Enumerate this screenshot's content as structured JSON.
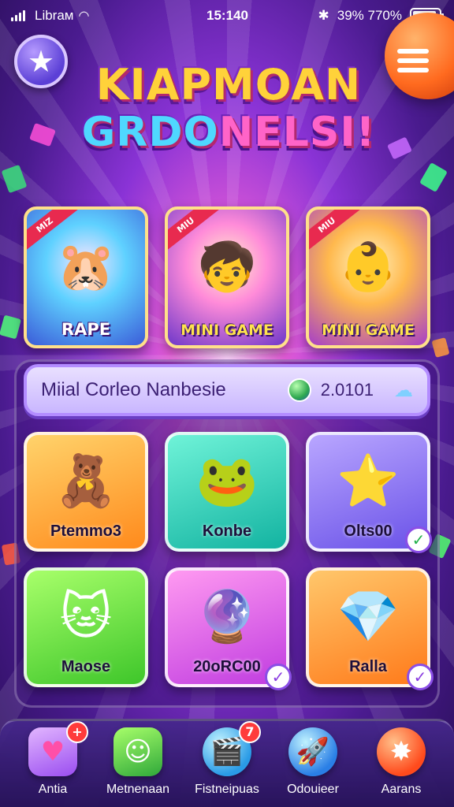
{
  "status_bar": {
    "carrier": "Librам",
    "time": "15:140",
    "battery_text": "39% 770%",
    "battery_level": 0.9
  },
  "header": {
    "title_line1": "KIAPMOAN",
    "title_line2_a": "GRDO",
    "title_line2_b": "NELSI!",
    "star_icon": "star-icon",
    "menu_icon": "hamburger-menu-icon"
  },
  "featured": [
    {
      "ribbon": "MIZ",
      "label": "RAPE",
      "art": "🐹"
    },
    {
      "ribbon": "MIU",
      "label": "MINI GAME",
      "art": "🧒"
    },
    {
      "ribbon": "MIU",
      "label": "MINI GAME",
      "art": "👶"
    }
  ],
  "search": {
    "text": "Miial Corleo Nanbesie",
    "value": "2.0101"
  },
  "games": [
    {
      "label": "Ptemmo3",
      "art": "🧸",
      "color": "orange"
    },
    {
      "label": "Konbe",
      "art": "🐸",
      "color": "teal"
    },
    {
      "label": "Olts00",
      "art": "⭐",
      "color": "purple",
      "checked": true
    },
    {
      "label": "Maose",
      "art": "🐱",
      "color": "green"
    },
    {
      "label": "20oRC00",
      "art": "🔮",
      "color": "pink",
      "checked": true
    },
    {
      "label": "Ralla",
      "art": "💎",
      "color": "amber",
      "checked": true
    }
  ],
  "bottom_nav": [
    {
      "label": "Antia",
      "icon": "heart-icon",
      "badge": "+"
    },
    {
      "label": "Metnenaan",
      "icon": "monster-icon",
      "badge": ""
    },
    {
      "label": "Fistneipuas",
      "icon": "clapper-icon",
      "badge": "7"
    },
    {
      "label": "Odouieer",
      "icon": "rocket-icon",
      "badge": ""
    },
    {
      "label": "Aarans",
      "icon": "star-burst-icon",
      "badge": ""
    }
  ]
}
